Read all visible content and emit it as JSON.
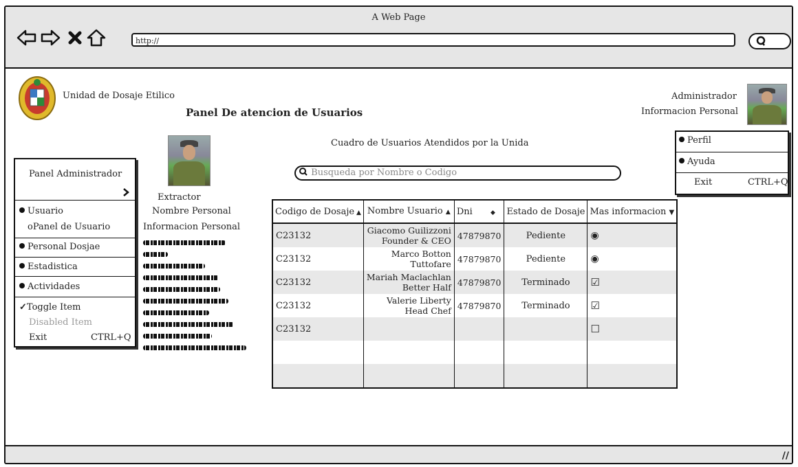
{
  "browser": {
    "title": "A Web Page",
    "url": "http://"
  },
  "header": {
    "org_name": "Unidad de Dosaje Etilico",
    "page_title": "Panel De atencion de Usuarios",
    "user_role": "Administrador",
    "user_info": "Informacion Personal"
  },
  "user_menu": {
    "items": [
      "Perfil",
      "Ayuda"
    ],
    "exit_label": "Exit",
    "exit_shortcut": "CTRL+Q"
  },
  "left_menu": {
    "title": "Panel Administrador",
    "items": [
      "Usuario",
      "oPanel de Usuario",
      "Personal Dosjae",
      "Estadistica",
      "Actividades"
    ],
    "toggle_item": "Toggle Item",
    "disabled_item": "Disabled Item",
    "exit_label": "Exit",
    "exit_shortcut": "CTRL+Q"
  },
  "extractor": {
    "role": "Extractor",
    "name": "Nombre  Personal",
    "info": "Informacion Personal"
  },
  "table": {
    "caption": "Cuadro de Usuarios Atendidos por la Unida",
    "search_placeholder": "Busqueda por Nombre o Codigo",
    "columns": [
      "Codigo de Dosaje",
      "Nombre Usuario",
      "Dni",
      "Estado de Dosaje",
      "Mas  informacion"
    ],
    "rows": [
      {
        "codigo": "C23132",
        "nombre1": "Giacomo Guilizzoni",
        "nombre2": "Founder & CEO",
        "dni": "47879870",
        "estado": "Pediente",
        "mas": "radio"
      },
      {
        "codigo": "C23132",
        "nombre1": "Marco Botton",
        "nombre2": "Tuttofare",
        "dni": "47879870",
        "estado": "Pediente",
        "mas": "radio"
      },
      {
        "codigo": "C23132",
        "nombre1": "Mariah Maclachlan",
        "nombre2": "Better Half",
        "dni": "47879870",
        "estado": "Terminado",
        "mas": "checked"
      },
      {
        "codigo": "C23132",
        "nombre1": "Valerie Liberty",
        "nombre2": "Head Chef",
        "dni": "47879870",
        "estado": "Terminado",
        "mas": "checked"
      },
      {
        "codigo": "C23132",
        "nombre1": "",
        "nombre2": "",
        "dni": "",
        "estado": "",
        "mas": "unchecked"
      },
      {
        "codigo": "",
        "nombre1": "",
        "nombre2": "",
        "dni": "",
        "estado": "",
        "mas": ""
      },
      {
        "codigo": "",
        "nombre1": "",
        "nombre2": "",
        "dni": "",
        "estado": "",
        "mas": ""
      }
    ]
  }
}
